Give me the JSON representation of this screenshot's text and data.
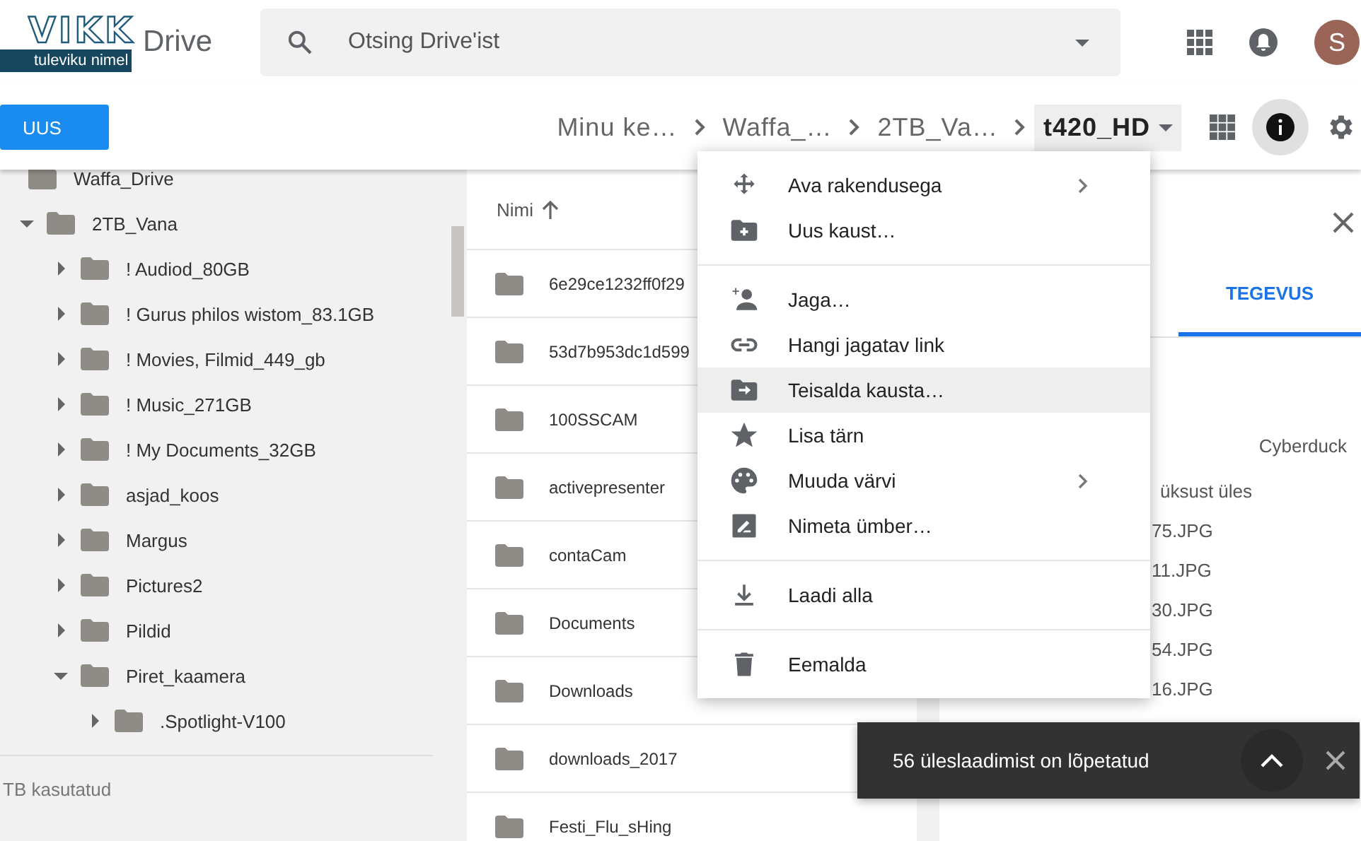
{
  "logo": {
    "name": "VIKK",
    "tagline": "tuleviku nimel"
  },
  "app_name": "Drive",
  "search": {
    "placeholder": "Otsing Drive'ist"
  },
  "account": {
    "initial": "S"
  },
  "new_button": "UUS",
  "breadcrumbs": [
    {
      "label": "Minu ke…",
      "selected": false
    },
    {
      "label": "Waffa_…",
      "selected": false
    },
    {
      "label": "2TB_Va…",
      "selected": false
    },
    {
      "label": "t420_HD",
      "selected": true
    }
  ],
  "tree": [
    {
      "label": "Waffa_Drive",
      "children": [
        {
          "label": "2TB_Vana",
          "expanded": true,
          "children": [
            {
              "label": "! Audiod_80GB",
              "expanded": false
            },
            {
              "label": "! Gurus philos wistom_83.1GB",
              "expanded": false
            },
            {
              "label": "! Movies, Filmid_449_gb",
              "expanded": false
            },
            {
              "label": "! Music_271GB",
              "expanded": false
            },
            {
              "label": "! My Documents_32GB",
              "expanded": false
            },
            {
              "label": "asjad_koos",
              "expanded": false
            },
            {
              "label": "Margus",
              "expanded": false
            },
            {
              "label": "Pictures2",
              "expanded": false
            },
            {
              "label": "Pildid",
              "expanded": false
            },
            {
              "label": "Piret_kaamera",
              "expanded": true,
              "children": [
                {
                  "label": ".Spotlight-V100",
                  "expanded": false
                }
              ]
            }
          ]
        }
      ]
    }
  ],
  "storage": "TB kasutatud",
  "file_list": {
    "column": "Nimi",
    "rows": [
      "6e29ce1232ff0f29",
      "53d7b953dc1d599",
      "100SSCAM",
      "activepresenter",
      "contaCam",
      "Documents",
      "Downloads",
      "downloads_2017",
      "Festi_Flu_sHing"
    ]
  },
  "details": {
    "tabs": [
      {
        "label": "TEGEVUS",
        "selected": true
      }
    ],
    "items": [
      "Cyberduck",
      "üksust üles",
      "75.JPG",
      "11.JPG",
      "30.JPG",
      "54.JPG",
      "16.JPG"
    ]
  },
  "context_menu": [
    [
      {
        "label": "Ava rakendusega",
        "submenu": true,
        "selected": false
      },
      {
        "label": "Uus kaust…",
        "submenu": false,
        "selected": false
      }
    ],
    [
      {
        "label": "Jaga…",
        "submenu": false,
        "selected": false
      },
      {
        "label": "Hangi jagatav link",
        "submenu": false,
        "selected": false
      },
      {
        "label": "Teisalda kausta…",
        "submenu": false,
        "selected": true
      },
      {
        "label": "Lisa tärn",
        "submenu": false,
        "selected": false
      },
      {
        "label": "Muuda värvi",
        "submenu": true,
        "selected": false
      },
      {
        "label": "Nimeta ümber…",
        "submenu": false,
        "selected": false
      }
    ],
    [
      {
        "label": "Laadi alla",
        "submenu": false,
        "selected": false
      }
    ],
    [
      {
        "label": "Eemalda",
        "submenu": false,
        "selected": false
      }
    ]
  ],
  "toast": {
    "message": "56 üleslaadimist on lõpetatud"
  }
}
